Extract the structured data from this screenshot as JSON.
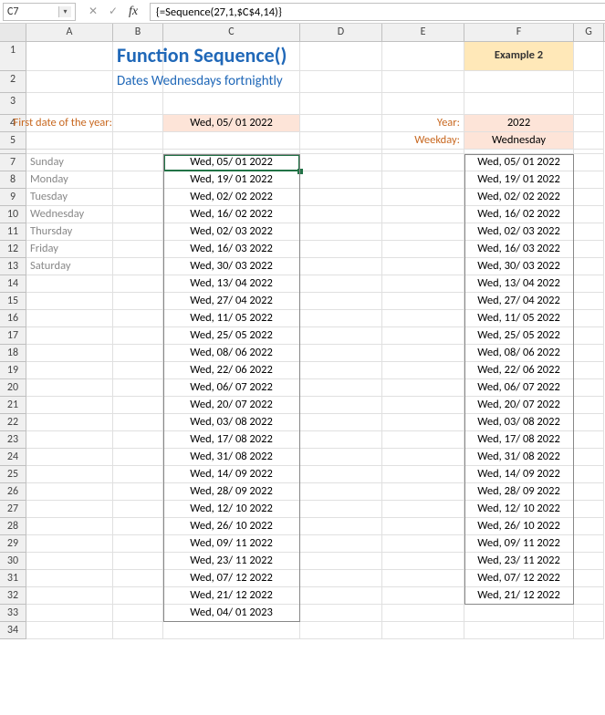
{
  "nameBox": "C7",
  "formula": "{=Sequence(27,1,$C$4,14)}",
  "columns": [
    "A",
    "B",
    "C",
    "D",
    "E",
    "F",
    "G"
  ],
  "rows": [
    "1",
    "2",
    "3",
    "4",
    "5",
    "7",
    "8",
    "9",
    "10",
    "11",
    "12",
    "13",
    "14",
    "15",
    "16",
    "17",
    "18",
    "19",
    "20",
    "21",
    "22",
    "23",
    "24",
    "25",
    "26",
    "27",
    "28",
    "29",
    "30",
    "31",
    "32",
    "33",
    "34"
  ],
  "title": "Function Sequence()",
  "subtitle": "Dates Wednesdays fortnightly",
  "exampleLabel": "Example 2",
  "firstDateLabel": "First date of the year:",
  "firstDateValue": "Wed, 05/ 01 2022",
  "yearLabel": "Year:",
  "yearValue": "2022",
  "weekdayLabel": "Weekday:",
  "weekdayValue": "Wednesday",
  "weekdays": [
    "Sunday",
    "Monday",
    "Tuesday",
    "Wednesday",
    "Thursday",
    "Friday",
    "Saturday"
  ],
  "datesC": [
    "Wed, 05/ 01 2022",
    "Wed, 19/ 01 2022",
    "Wed, 02/ 02 2022",
    "Wed, 16/ 02 2022",
    "Wed, 02/ 03 2022",
    "Wed, 16/ 03 2022",
    "Wed, 30/ 03 2022",
    "Wed, 13/ 04 2022",
    "Wed, 27/ 04 2022",
    "Wed, 11/ 05 2022",
    "Wed, 25/ 05 2022",
    "Wed, 08/ 06 2022",
    "Wed, 22/ 06 2022",
    "Wed, 06/ 07 2022",
    "Wed, 20/ 07 2022",
    "Wed, 03/ 08 2022",
    "Wed, 17/ 08 2022",
    "Wed, 31/ 08 2022",
    "Wed, 14/ 09 2022",
    "Wed, 28/ 09 2022",
    "Wed, 12/ 10 2022",
    "Wed, 26/ 10 2022",
    "Wed, 09/ 11 2022",
    "Wed, 23/ 11 2022",
    "Wed, 07/ 12 2022",
    "Wed, 21/ 12 2022",
    "Wed, 04/ 01 2023"
  ],
  "datesF": [
    "Wed, 05/ 01 2022",
    "Wed, 19/ 01 2022",
    "Wed, 02/ 02 2022",
    "Wed, 16/ 02 2022",
    "Wed, 02/ 03 2022",
    "Wed, 16/ 03 2022",
    "Wed, 30/ 03 2022",
    "Wed, 13/ 04 2022",
    "Wed, 27/ 04 2022",
    "Wed, 11/ 05 2022",
    "Wed, 25/ 05 2022",
    "Wed, 08/ 06 2022",
    "Wed, 22/ 06 2022",
    "Wed, 06/ 07 2022",
    "Wed, 20/ 07 2022",
    "Wed, 03/ 08 2022",
    "Wed, 17/ 08 2022",
    "Wed, 31/ 08 2022",
    "Wed, 14/ 09 2022",
    "Wed, 28/ 09 2022",
    "Wed, 12/ 10 2022",
    "Wed, 26/ 10 2022",
    "Wed, 09/ 11 2022",
    "Wed, 23/ 11 2022",
    "Wed, 07/ 12 2022",
    "Wed, 21/ 12 2022"
  ]
}
